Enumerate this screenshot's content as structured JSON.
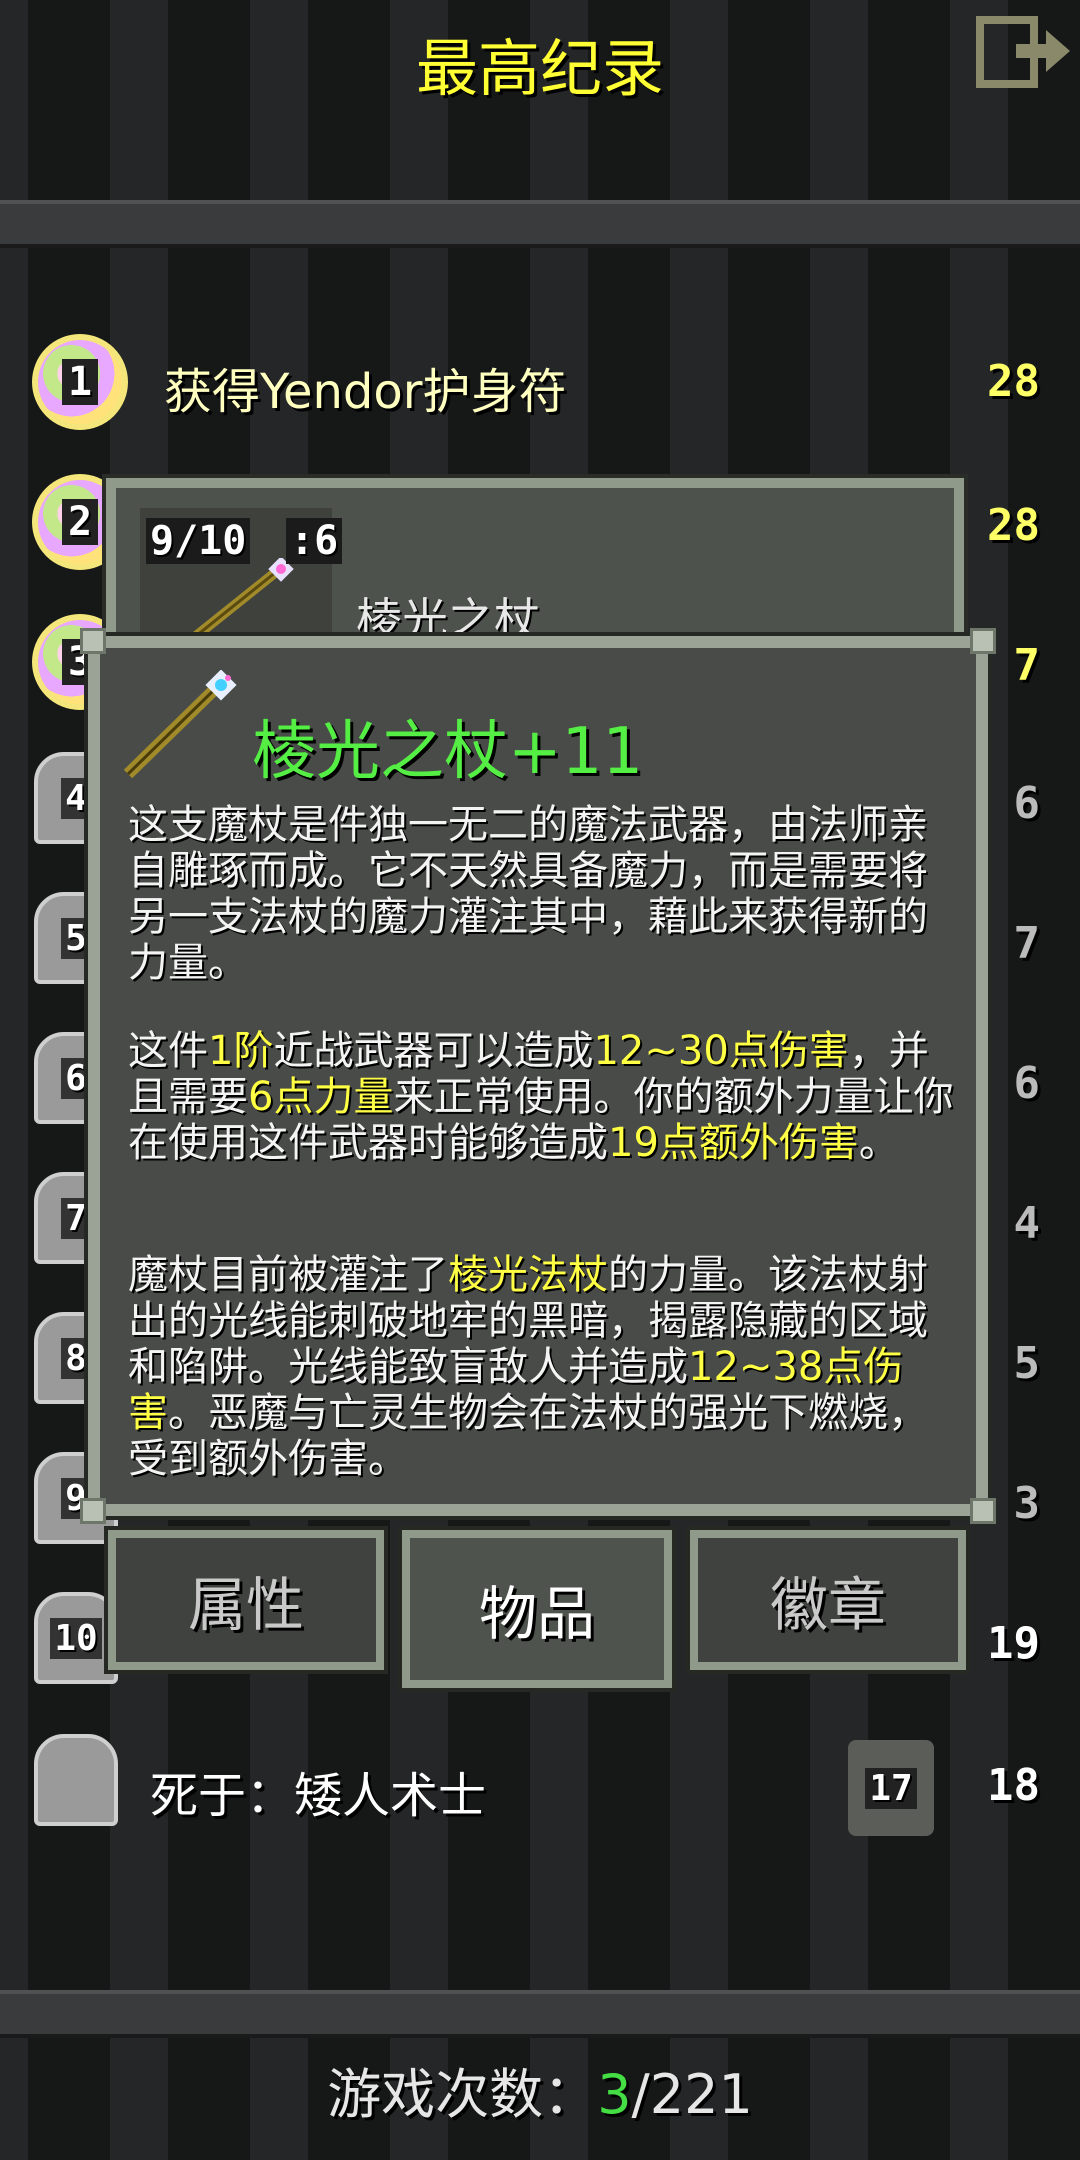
{
  "header": {
    "title": "最高纪录",
    "exit_icon": "exit-door-icon"
  },
  "rankings": [
    {
      "rank": "1",
      "label": "获得Yendor护身符",
      "depth": "28"
    },
    {
      "rank": "2",
      "depth": "28"
    },
    {
      "rank": "3",
      "depth": "7"
    },
    {
      "rank": "4",
      "depth": "6"
    },
    {
      "rank": "5",
      "depth": "7"
    },
    {
      "rank": "6",
      "depth": "6"
    },
    {
      "rank": "7",
      "depth": "4"
    },
    {
      "rank": "8",
      "depth": "5"
    },
    {
      "rank": "9",
      "depth": "3"
    },
    {
      "rank": "10",
      "depth": "19"
    }
  ],
  "last_run": {
    "label": "死于：矮人术士",
    "level": "17",
    "depth": "18"
  },
  "item_header": {
    "durability": "9/10",
    "strength": ":6",
    "name": "棱光之杖"
  },
  "item_info": {
    "title": "棱光之杖+11",
    "para1": "这支魔杖是件独一无二的魔法武器，由法师亲自雕琢而成。它不天然具备魔力，而是需要将另一支法杖的魔力灌注其中，藉此来获得新的力量。",
    "para2": {
      "t1": "这件",
      "h1": "1阶",
      "t2": "近战武器可以造成",
      "h2": "12~30点伤害",
      "t3": "，并且需要",
      "h3": "6点力量",
      "t4": "来正常使用。你的额外力量让你在使用这件武器时能够造成",
      "h4": "19点额外伤害",
      "t5": "。"
    },
    "para3": {
      "t1": "魔杖目前被灌注了",
      "h1": "棱光法杖",
      "t2": "的力量。该法杖射出的光线能刺破地牢的黑暗，揭露隐藏的区域和陷阱。光线能致盲敌人并造成",
      "h2": "12~38点伤害",
      "t3": "。恶魔与亡灵生物会在法杖的强光下燃烧，受到额外伤害。"
    }
  },
  "tabs": {
    "stats": "属性",
    "items": "物品",
    "badges": "徽章",
    "active": "物品"
  },
  "footer": {
    "label": "游戏次数：",
    "current": "3",
    "total": "/221"
  },
  "colors": {
    "title_yellow": "#ffff33",
    "highlight_yellow": "#ffff44",
    "item_green": "#55ee44",
    "count_green": "#44dd44"
  }
}
